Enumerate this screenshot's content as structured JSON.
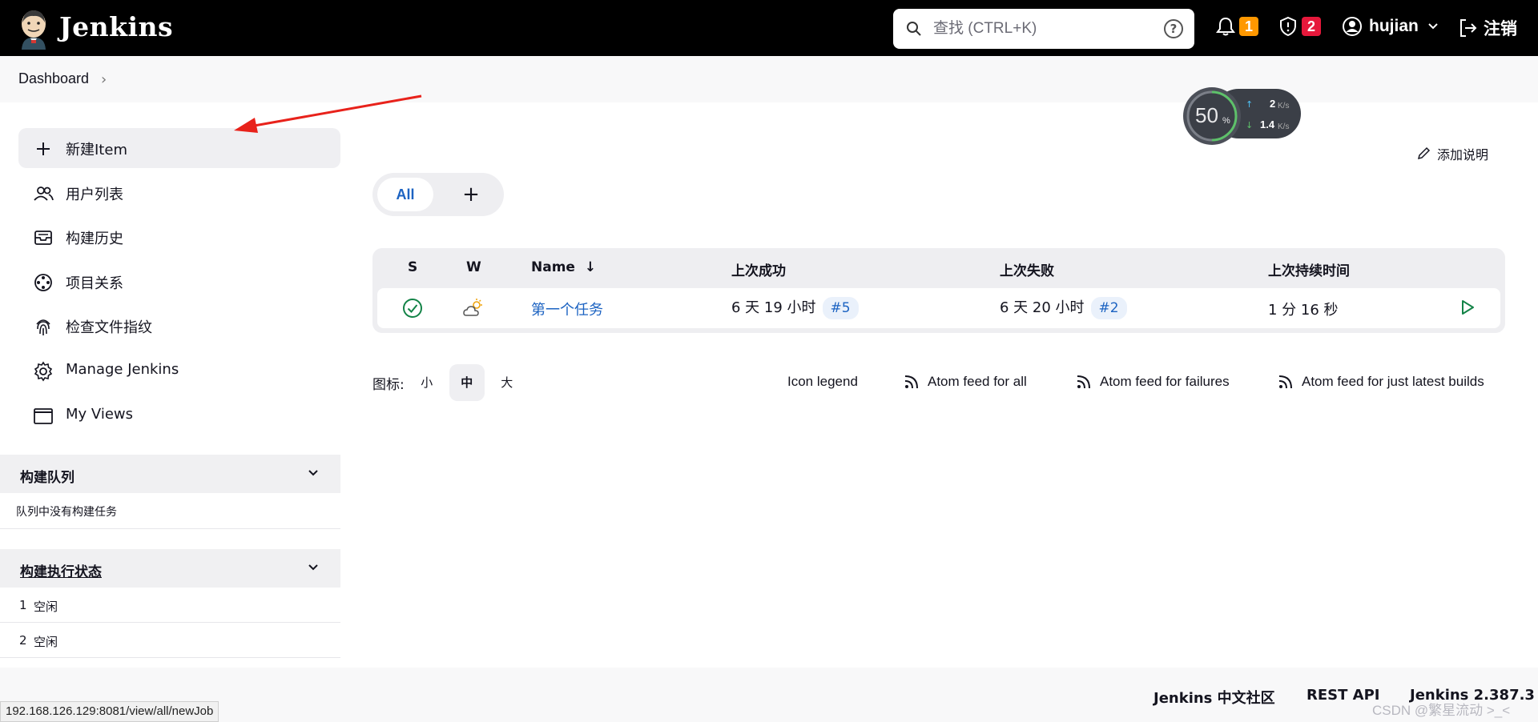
{
  "header": {
    "brand": "Jenkins",
    "search_placeholder": "查找 (CTRL+K)",
    "notifications_count": "1",
    "security_count": "2",
    "user": "hujian",
    "logout": "注销"
  },
  "breadcrumb": {
    "item": "Dashboard"
  },
  "sidebar": {
    "tasks": [
      {
        "label": "新建Item",
        "icon": "plus-icon"
      },
      {
        "label": "用户列表",
        "icon": "users-icon"
      },
      {
        "label": "构建历史",
        "icon": "inbox-icon"
      },
      {
        "label": "项目关系",
        "icon": "relationship-icon"
      },
      {
        "label": "检查文件指纹",
        "icon": "fingerprint-icon"
      },
      {
        "label": "Manage Jenkins",
        "icon": "gear-icon"
      },
      {
        "label": "My Views",
        "icon": "window-icon"
      }
    ],
    "queue": {
      "title": "构建队列",
      "empty": "队列中没有构建任务"
    },
    "executors": {
      "title": "构建执行状态",
      "rows": [
        {
          "num": "1",
          "status": "空闲"
        },
        {
          "num": "2",
          "status": "空闲"
        }
      ]
    }
  },
  "net_widget": {
    "percent": "50",
    "percent_unit": "%",
    "up": "2",
    "up_unit": "K/s",
    "down": "1.4",
    "down_unit": "K/s"
  },
  "add_description": "添加说明",
  "tabs": {
    "all": "All",
    "add": "+"
  },
  "jobs_table": {
    "headers": {
      "s": "S",
      "w": "W",
      "name": "Name",
      "sort": "↓",
      "last_success": "上次成功",
      "last_failure": "上次失败",
      "last_duration": "上次持续时间"
    },
    "rows": [
      {
        "name": "第一个任务",
        "last_success": "6 天 19 小时",
        "success_build": "#5",
        "last_failure": "6 天 20 小时",
        "failure_build": "#2",
        "duration": "1 分 16 秒"
      }
    ]
  },
  "icon_size": {
    "label": "图标:",
    "small": "小",
    "medium": "中",
    "large": "大"
  },
  "links": {
    "icon_legend": "Icon legend",
    "feed_all": "Atom feed for all",
    "feed_failures": "Atom feed for failures",
    "feed_latest": "Atom feed for just latest builds"
  },
  "footer": {
    "community": "Jenkins 中文社区",
    "rest_api": "REST API",
    "version": "Jenkins 2.387.3"
  },
  "status_url": "192.168.126.129:8081/view/all/newJob",
  "watermark": "CSDN @繁星流动 >_<",
  "colors": {
    "header_bg": "#000000",
    "link": "#1c63c2",
    "success": "#138347",
    "annotation_arrow": "#e8221b"
  }
}
